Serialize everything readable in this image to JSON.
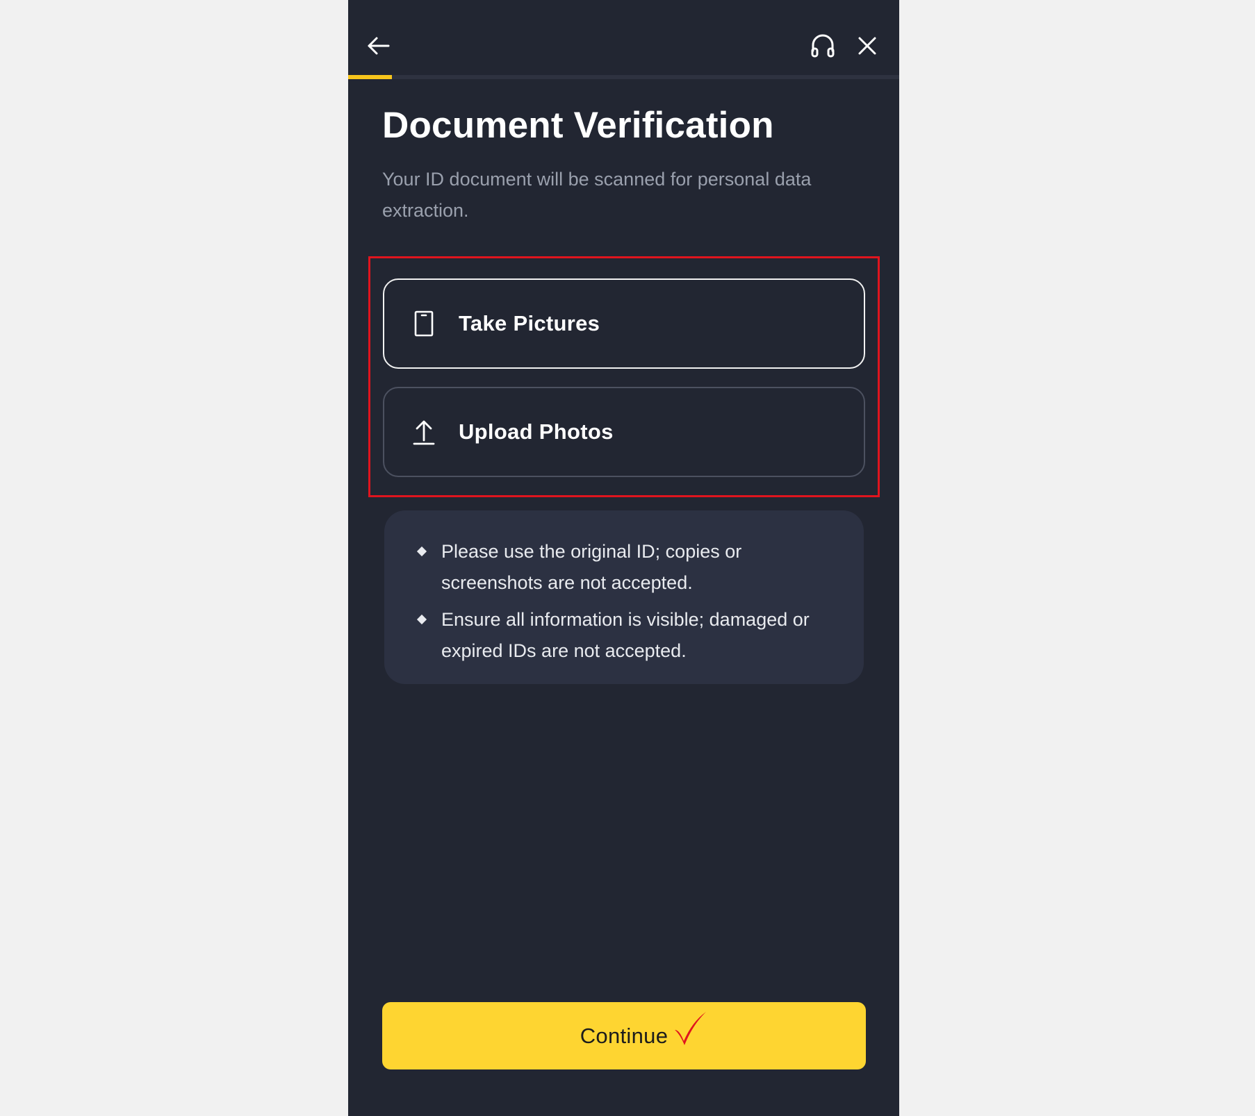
{
  "header": {
    "back_icon": "arrow-left-icon",
    "support_icon": "headset-icon",
    "close_icon": "close-icon",
    "progress": 0.08,
    "progress_color": "#f7c51c"
  },
  "page": {
    "title": "Document Verification",
    "subtitle": "Your ID document will be scanned for personal data extraction."
  },
  "options": [
    {
      "label": "Take Pictures",
      "icon": "phone-icon"
    },
    {
      "label": "Upload Photos",
      "icon": "upload-icon"
    }
  ],
  "notes": [
    "Please use the original ID; copies or screenshots are not accepted.",
    "Ensure all information is visible; damaged or expired IDs are not accepted."
  ],
  "continue": {
    "label": "Continue",
    "color": "#fed531"
  },
  "colors": {
    "background": "#222632",
    "highlight": "#e0141e",
    "checkmark": "#e0141e"
  }
}
